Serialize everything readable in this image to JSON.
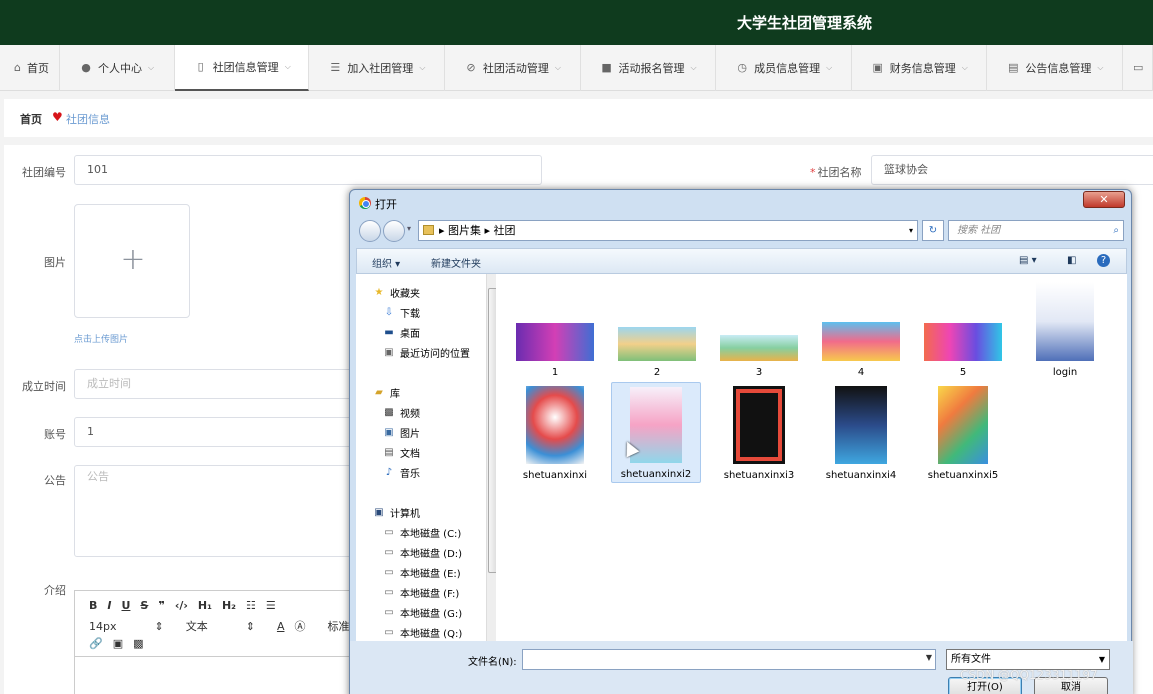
{
  "app": {
    "title": "大学生社团管理系统"
  },
  "nav": [
    {
      "label": "首页",
      "icon": "home-icon"
    },
    {
      "label": "个人中心",
      "icon": "user-icon"
    },
    {
      "label": "社团信息管理",
      "icon": "badge-icon"
    },
    {
      "label": "加入社团管理",
      "icon": "list-icon"
    },
    {
      "label": "社团活动管理",
      "icon": "activity-icon"
    },
    {
      "label": "活动报名管理",
      "icon": "briefcase-icon"
    },
    {
      "label": "成员信息管理",
      "icon": "clock-icon"
    },
    {
      "label": "财务信息管理",
      "icon": "chart-icon"
    },
    {
      "label": "公告信息管理",
      "icon": "clipboard-icon"
    }
  ],
  "breadcrumb": {
    "home": "首页",
    "current": "社团信息"
  },
  "form": {
    "id_label": "社团编号",
    "id_value": "101",
    "name_label": "社团名称",
    "name_value": "篮球协会",
    "image_label": "图片",
    "upload_hint": "点击上传图片",
    "date_label": "成立时间",
    "date_placeholder": "成立时间",
    "account_label": "账号",
    "account_value": "1",
    "notice_label": "公告",
    "notice_placeholder": "公告",
    "intro_label": "介绍",
    "editor": {
      "font_size": "14px",
      "text_type": "文本",
      "heading": "标准字"
    }
  },
  "dialog": {
    "title": "打开",
    "path": [
      "图片集",
      "社团"
    ],
    "search_placeholder": "搜索 社团",
    "organize": "组织 ▾",
    "new_folder": "新建文件夹",
    "favorites": "收藏夹",
    "fav_items": [
      "下载",
      "桌面",
      "最近访问的位置"
    ],
    "library": "库",
    "lib_items": [
      "视频",
      "图片",
      "文档",
      "音乐"
    ],
    "computer": "计算机",
    "drives": [
      "本地磁盘 (C:)",
      "本地磁盘 (D:)",
      "本地磁盘 (E:)",
      "本地磁盘 (F:)",
      "本地磁盘 (G:)",
      "本地磁盘 (Q:)"
    ],
    "files": [
      "1",
      "2",
      "3",
      "4",
      "5",
      "login",
      "shetuanxinxi",
      "shetuanxinxi2",
      "shetuanxinxi3",
      "shetuanxinxi4",
      "shetuanxinxi5"
    ],
    "filename_label": "文件名(N):",
    "filetype": "所有文件",
    "open_button": "打开(O)",
    "cancel_button": "取消"
  },
  "watermark": "CSDN @QQ123311197"
}
